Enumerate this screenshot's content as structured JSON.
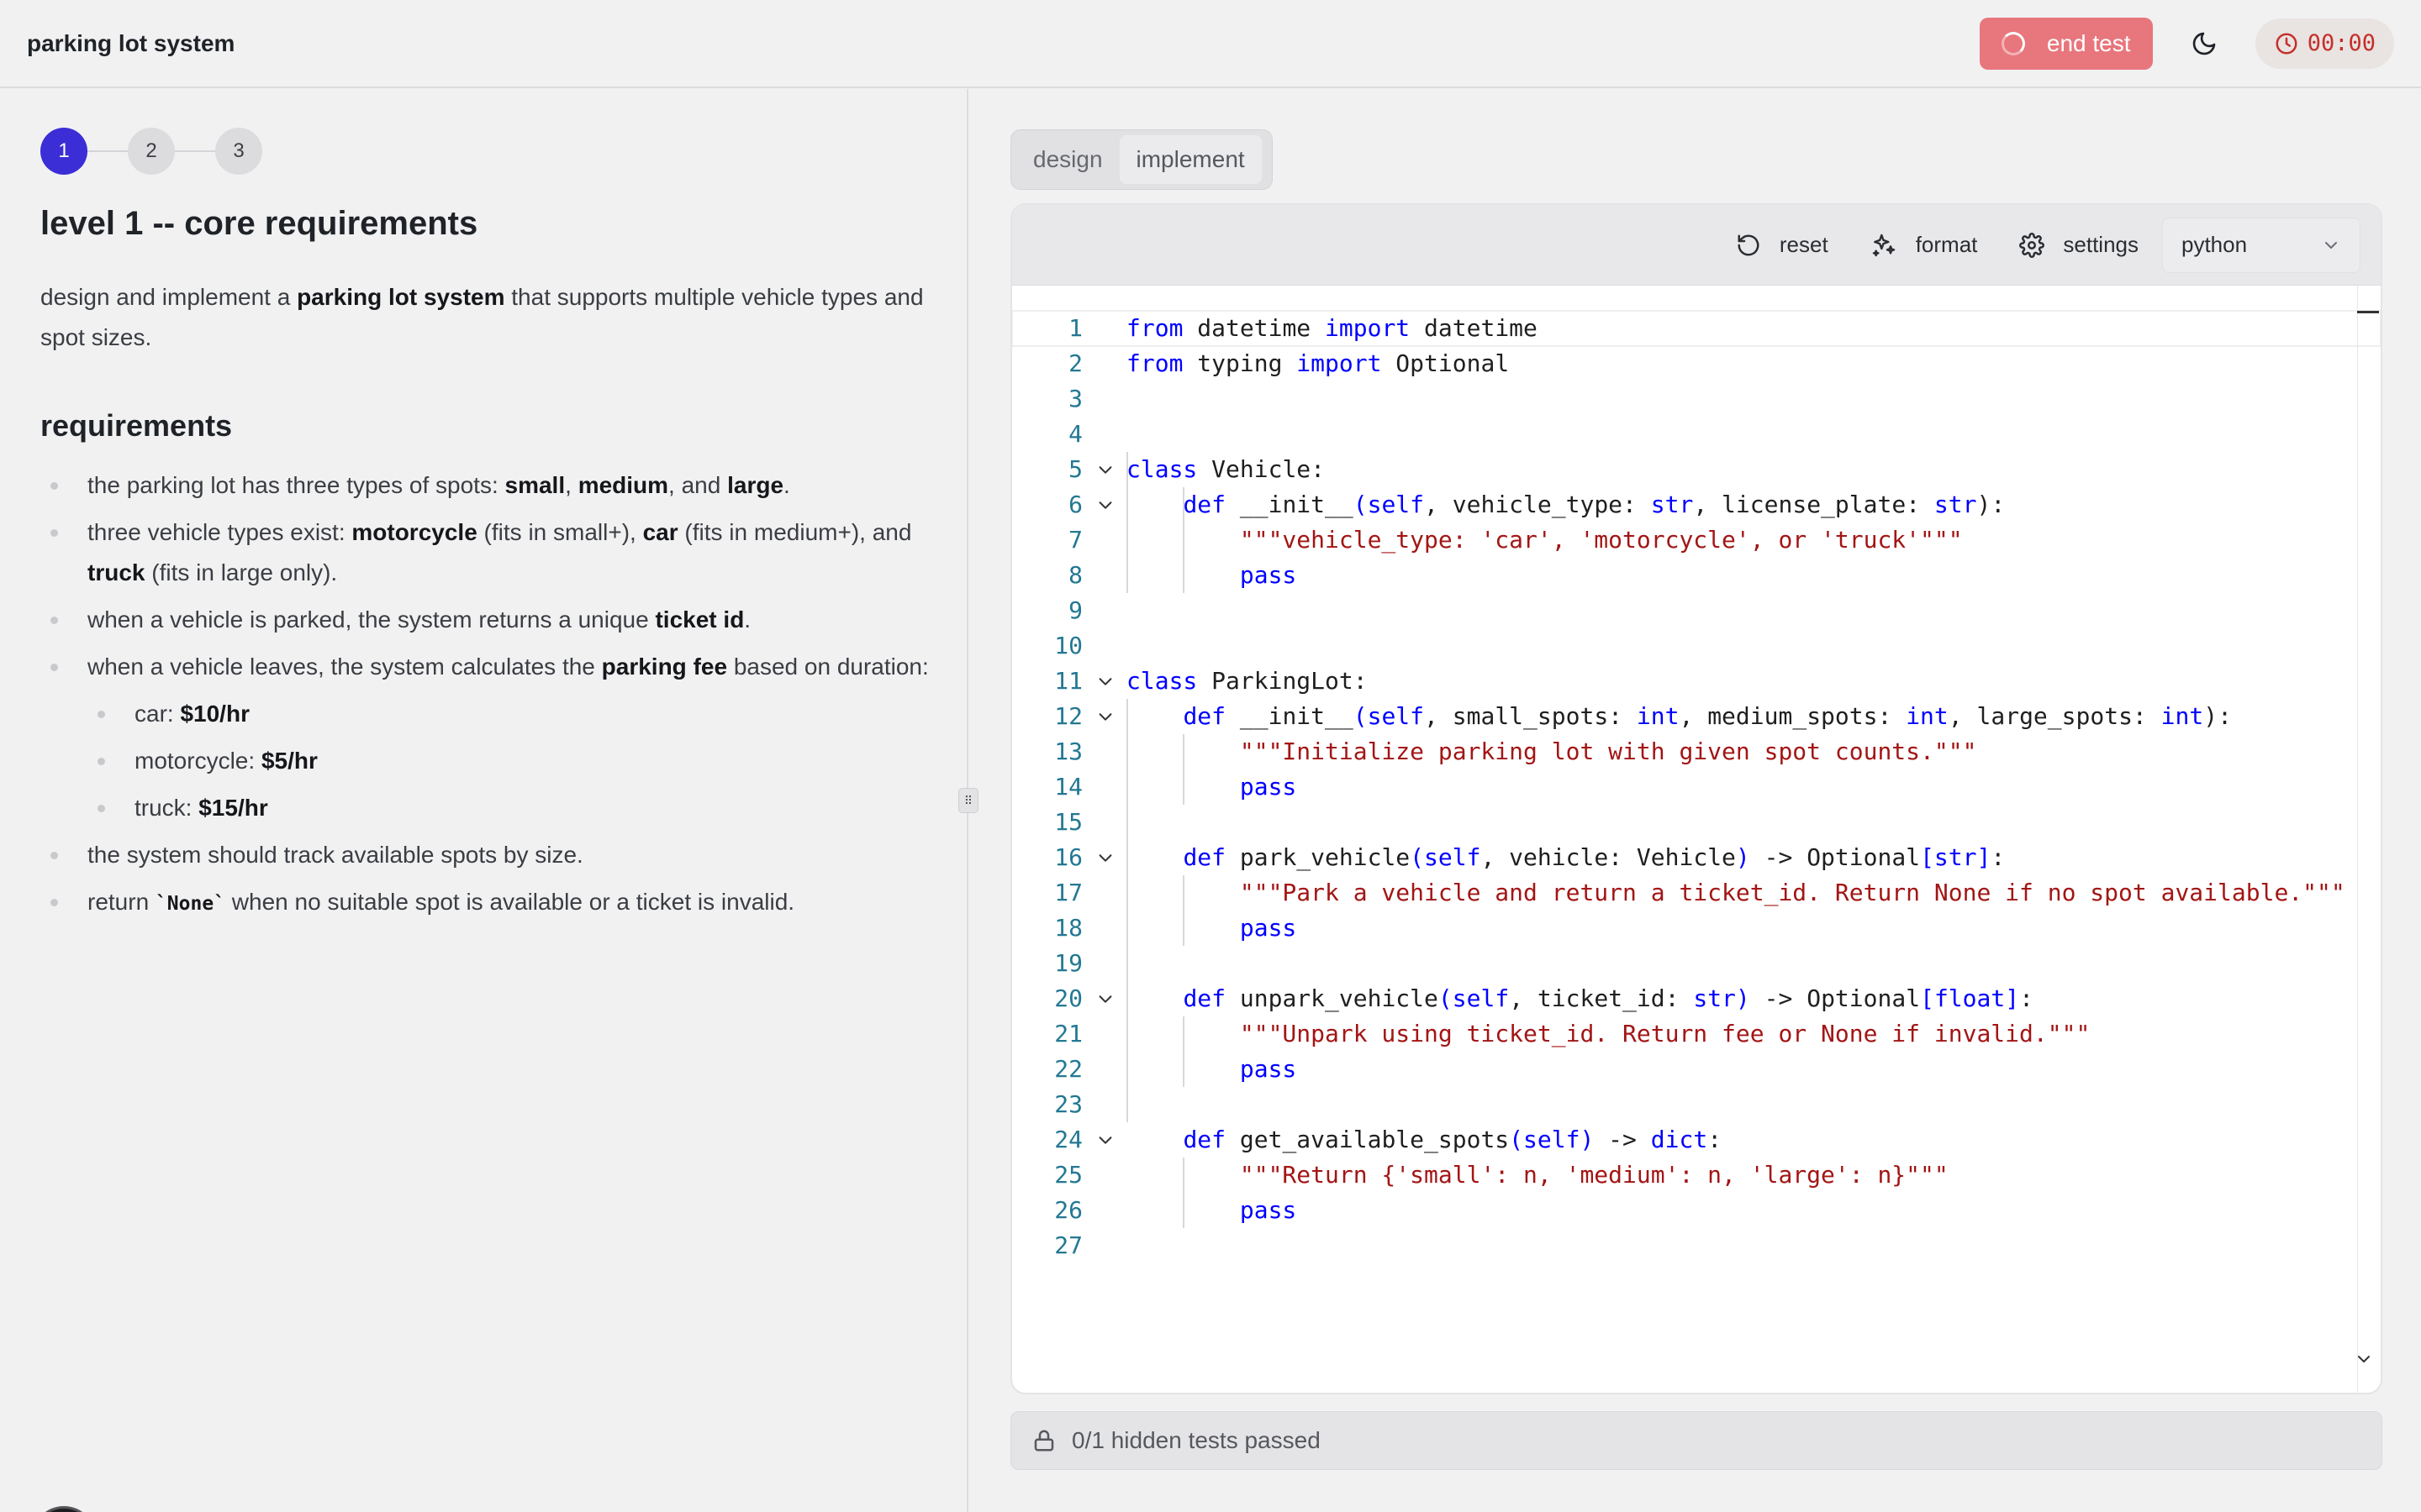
{
  "header": {
    "title": "parking lot system",
    "end_test_label": "end test",
    "timer": "00:00"
  },
  "steps": [
    "1",
    "2",
    "3"
  ],
  "problem": {
    "level_title": "level 1 -- core requirements",
    "intro": {
      "pre": "design and implement a ",
      "bold": "parking lot system",
      "post": " that supports multiple vehicle types and spot sizes."
    },
    "requirements_title": "requirements",
    "req1": {
      "t1": "the parking lot has three types of spots: ",
      "b1": "small",
      "t2": ", ",
      "b2": "medium",
      "t3": ", and ",
      "b3": "large",
      "t4": "."
    },
    "req2": {
      "t1": "three vehicle types exist: ",
      "b1": "motorcycle",
      "t2": " (fits in small+), ",
      "b2": "car",
      "t3": " (fits in medium+), and ",
      "b3": "truck",
      "t4": " (fits in large only)."
    },
    "req3": {
      "t1": "when a vehicle is parked, the system returns a unique ",
      "b1": "ticket id",
      "t2": "."
    },
    "req4": {
      "t1": "when a vehicle leaves, the system calculates the ",
      "b1": "parking fee",
      "t2": " based on duration:"
    },
    "fees": [
      {
        "label": "car: ",
        "value": "$10/hr"
      },
      {
        "label": "motorcycle: ",
        "value": "$5/hr"
      },
      {
        "label": "truck: ",
        "value": "$15/hr"
      }
    ],
    "req5": "the system should track available spots by size.",
    "req6": {
      "t1": "return ",
      "code": "`None`",
      "t2": " when no suitable spot is available or a ticket is invalid."
    }
  },
  "right": {
    "tabs": [
      "design",
      "implement"
    ],
    "toolbar": {
      "reset": "reset",
      "format": "format",
      "settings": "settings",
      "language": "python"
    },
    "tests_status": "0/1 hidden tests passed"
  },
  "code": {
    "line_numbers": [
      "1",
      "2",
      "3",
      "4",
      "5",
      "6",
      "7",
      "8",
      "9",
      "10",
      "11",
      "12",
      "13",
      "14",
      "15",
      "16",
      "17",
      "18",
      "19",
      "20",
      "21",
      "22",
      "23",
      "24",
      "25",
      "26",
      "27"
    ],
    "l1": [
      "from",
      " datetime ",
      "import",
      " datetime"
    ],
    "l2": [
      "from",
      " typing ",
      "import",
      " Optional"
    ],
    "l5": [
      "class",
      " Vehicle:"
    ],
    "l6": [
      "    ",
      "def",
      " ",
      "__init__",
      "(",
      "self",
      ", vehicle_type: ",
      "str",
      ", license_plate: ",
      "str",
      "):"
    ],
    "l7": [
      "        ",
      "\"\"\"vehicle_type: 'car', 'motorcycle', or 'truck'\"\"\""
    ],
    "l8": [
      "        ",
      "pass"
    ],
    "l11": [
      "class",
      " ParkingLot:"
    ],
    "l12": [
      "    ",
      "def",
      " ",
      "__init__",
      "(",
      "self",
      ", small_spots: ",
      "int",
      ", medium_spots: ",
      "int",
      ", large_spots: ",
      "int",
      "):"
    ],
    "l13": [
      "        ",
      "\"\"\"Initialize parking lot with given spot counts.\"\"\""
    ],
    "l14": [
      "        ",
      "pass"
    ],
    "l16": [
      "    ",
      "def",
      " park_vehicle",
      "(",
      "self",
      ", vehicle: Vehicle",
      ")",
      " -> Optional",
      "[",
      "str",
      "]",
      ":"
    ],
    "l17": [
      "        ",
      "\"\"\"Park a vehicle and return a ticket_id. Return None if no spot available.\"\"\""
    ],
    "l18": [
      "        ",
      "pass"
    ],
    "l20": [
      "    ",
      "def",
      " unpark_vehicle",
      "(",
      "self",
      ", ticket_id: ",
      "str",
      ")",
      " -> Optional",
      "[",
      "float",
      "]",
      ":"
    ],
    "l21": [
      "        ",
      "\"\"\"Unpark using ticket_id. Return fee or None if invalid.\"\"\""
    ],
    "l22": [
      "        ",
      "pass"
    ],
    "l24": [
      "    ",
      "def",
      " get_available_spots",
      "(",
      "self",
      ")",
      " -> ",
      "dict",
      ":"
    ],
    "l25": [
      "        ",
      "\"\"\"Return {'small': n, 'medium': n, 'large': n}\"\"\""
    ],
    "l26": [
      "        ",
      "pass"
    ]
  },
  "colors": {
    "accent": "#3b2ed6",
    "end_test_bg": "#e8767d",
    "timer_text": "#c4302b",
    "keyword": "#0000ff",
    "string": "#a31515",
    "line_number": "#237893"
  },
  "icons": {
    "end_test": "spinner-icon",
    "theme": "moon-icon",
    "timer": "clock-icon",
    "reset": "rotate-ccw-icon",
    "format": "sparkles-icon",
    "settings": "gear-icon",
    "language": "chevron-down-icon",
    "tests": "lock-icon"
  }
}
